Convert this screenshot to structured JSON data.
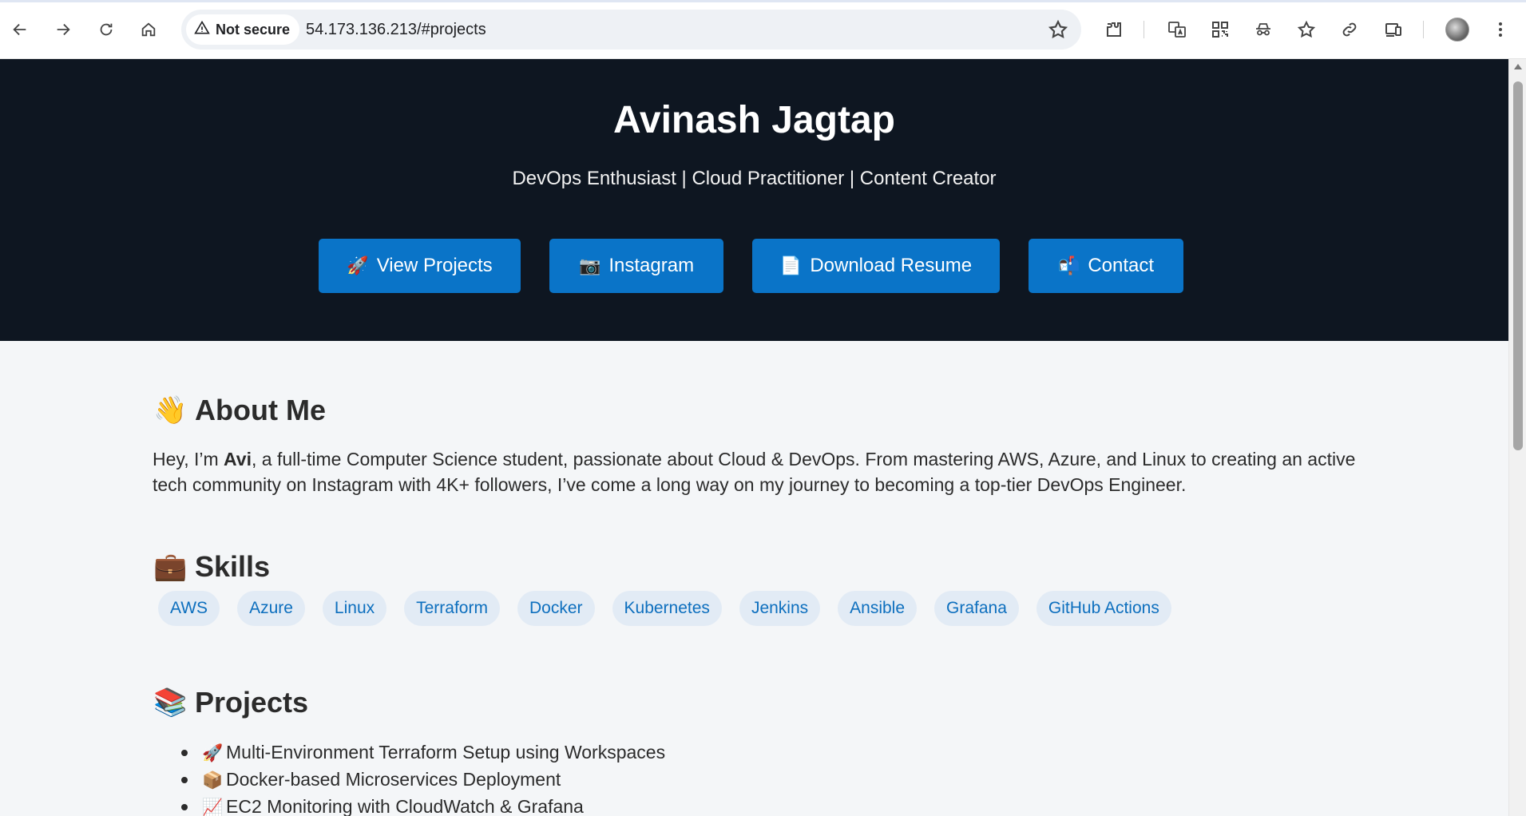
{
  "browser": {
    "security_label": "Not secure",
    "url": "54.173.136.213/#projects",
    "icons": [
      "back-icon",
      "forward-icon",
      "reload-icon",
      "home-icon",
      "warning-icon",
      "star-icon",
      "extensions-icon",
      "translate-icon",
      "qr-code-icon",
      "incognito-icon",
      "favorites-icon",
      "link-icon",
      "devices-icon",
      "profile-avatar",
      "more-menu-icon"
    ]
  },
  "hero": {
    "name": "Avinash Jagtap",
    "tagline": "DevOps Enthusiast | Cloud Practitioner | Content Creator",
    "buttons": [
      {
        "emoji": "🚀",
        "label": "View Projects"
      },
      {
        "emoji": "📷",
        "label": "Instagram"
      },
      {
        "emoji": "📄",
        "label": "Download Resume"
      },
      {
        "emoji": "📬",
        "label": "Contact"
      }
    ],
    "background_color": "#0e1621",
    "button_color": "#0a74c8"
  },
  "about": {
    "emoji": "👋",
    "title": "About Me",
    "text_before": "Hey, I’m ",
    "text_bold": "Avi",
    "text_after": ", a full-time Computer Science student, passionate about Cloud & DevOps. From mastering AWS, Azure, and Linux to creating an active tech community on Instagram with 4K+ followers, I’ve come a long way on my journey to becoming a top-tier DevOps Engineer."
  },
  "skills": {
    "emoji": "💼",
    "title": "Skills",
    "items": [
      "AWS",
      "Azure",
      "Linux",
      "Terraform",
      "Docker",
      "Kubernetes",
      "Jenkins",
      "Ansible",
      "Grafana",
      "GitHub Actions"
    ],
    "tag_color": "#0d6fbe",
    "tag_background": "#e2ebf5"
  },
  "projects": {
    "emoji": "📚",
    "title": "Projects",
    "items": [
      {
        "emoji": "🚀",
        "label": "Multi-Environment Terraform Setup using Workspaces"
      },
      {
        "emoji": "📦",
        "label": "Docker-based Microservices Deployment"
      },
      {
        "emoji": "📈",
        "label": "EC2 Monitoring with CloudWatch & Grafana"
      }
    ]
  }
}
